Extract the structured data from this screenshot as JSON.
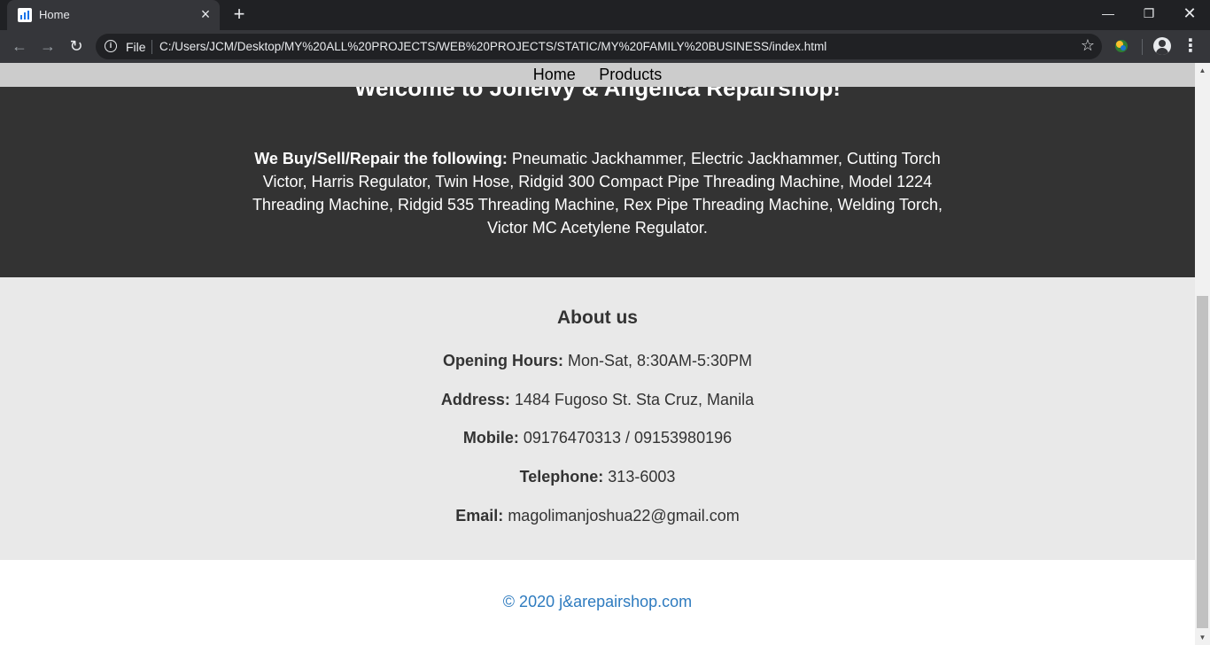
{
  "browser": {
    "tab_title": "Home",
    "new_tab_label": "+",
    "omnibox": {
      "scheme_label": "File",
      "url": "C:/Users/JCM/Desktop/MY%20ALL%20PROJECTS/WEB%20PROJECTS/STATIC/MY%20FAMILY%20BUSINESS/index.html"
    },
    "icons": [
      "favicon-icon",
      "close-icon",
      "plus-icon",
      "minimize-icon",
      "maximize-icon",
      "window-close-icon",
      "back-icon",
      "forward-icon",
      "reload-icon",
      "info-icon",
      "star-icon",
      "extension-icon",
      "profile-icon",
      "menu-icon"
    ]
  },
  "page": {
    "nav": {
      "items": [
        {
          "label": "Home"
        },
        {
          "label": "Products"
        }
      ]
    },
    "hero": {
      "title": "Welcome to Jonelvy & Angelica Repairshop!",
      "intro_label": "We Buy/Sell/Repair the following:",
      "intro_text": " Pneumatic Jackhammer, Electric Jackhammer, Cutting Torch Victor, Harris Regulator, Twin Hose, Ridgid 300 Compact Pipe Threading Machine, Model 1224 Threading Machine, Ridgid 535 Threading Machine, Rex Pipe Threading Machine, Welding Torch, Victor MC Acetylene Regulator."
    },
    "about": {
      "heading": "About us",
      "lines": [
        {
          "label": "Opening Hours:",
          "value": " Mon-Sat, 8:30AM-5:30PM"
        },
        {
          "label": "Address:",
          "value": " 1484 Fugoso St. Sta Cruz, Manila"
        },
        {
          "label": "Mobile:",
          "value": " 09176470313 / 09153980196"
        },
        {
          "label": "Telephone:",
          "value": " 313-6003"
        },
        {
          "label": "Email:",
          "value": " magolimanjoshua22@gmail.com"
        }
      ]
    },
    "footer": {
      "text": "© 2020 j&arepairshop.com"
    }
  },
  "colors": {
    "hero_bg": "#333333",
    "nav_bg": "#cccccc",
    "about_bg": "#e9e9e9",
    "footer_link": "#2e7bbf"
  }
}
